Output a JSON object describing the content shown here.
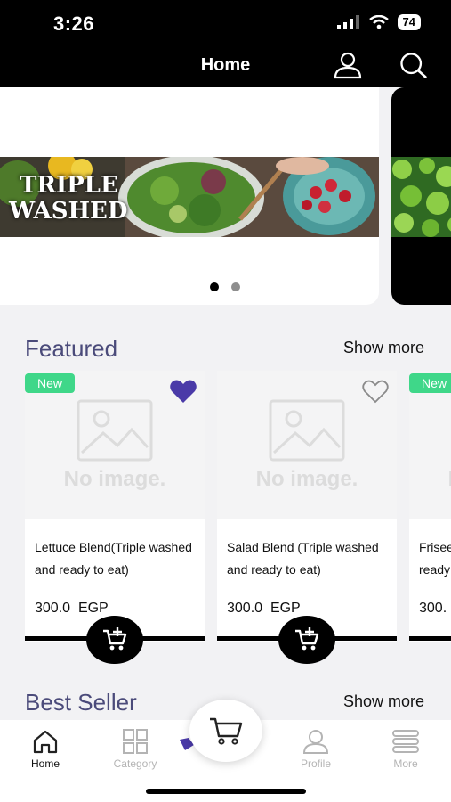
{
  "status_bar": {
    "time": "3:26",
    "battery": "74"
  },
  "nav": {
    "title": "Home"
  },
  "banner": {
    "text_line1": "TRIPLE",
    "text_line2": "WASHED"
  },
  "featured": {
    "title": "Featured",
    "show_more": "Show more"
  },
  "best_seller": {
    "title": "Best Seller",
    "show_more": "Show more"
  },
  "no_image_text": "No image.",
  "products": [
    {
      "badge": "New",
      "name": "Lettuce Blend(Triple washed and ready to eat)",
      "price": "300.0",
      "currency": "EGP",
      "favorite": true
    },
    {
      "badge": "",
      "name": "Salad Blend (Triple washed and ready to eat)",
      "price": "300.0",
      "currency": "EGP",
      "favorite": false
    },
    {
      "badge": "New",
      "name": "Frisee ready",
      "price": "300.",
      "currency": "",
      "favorite": false
    }
  ],
  "tabs": [
    {
      "label": "Home",
      "icon": "home-icon",
      "active": true
    },
    {
      "label": "Category",
      "icon": "grid-icon",
      "active": false
    },
    {
      "label": "Profile",
      "icon": "person-icon",
      "active": false
    },
    {
      "label": "More",
      "icon": "menu-icon",
      "active": false
    }
  ],
  "colors": {
    "accent": "#4a3aa8",
    "badge": "#3fd789",
    "title": "#4b4b7a"
  }
}
